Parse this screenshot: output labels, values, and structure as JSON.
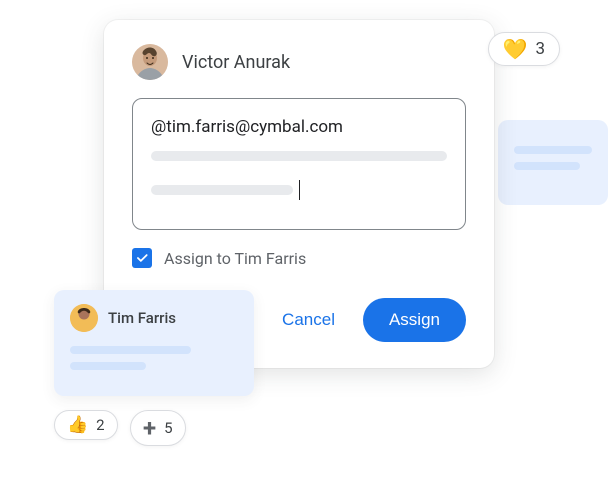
{
  "dialog": {
    "author": "Victor Anurak",
    "mention_text": "@tim.farris@cymbal.com",
    "assign_label": "Assign to Tim Farris",
    "cancel_label": "Cancel",
    "assign_button_label": "Assign",
    "assign_checked": true
  },
  "side_card": {
    "name": "Tim Farris"
  },
  "reactions": {
    "heart": {
      "emoji": "💛",
      "count": "3"
    },
    "thumb": {
      "emoji": "👍",
      "count": "2"
    },
    "plus": {
      "icon": "+",
      "count": "5"
    }
  }
}
